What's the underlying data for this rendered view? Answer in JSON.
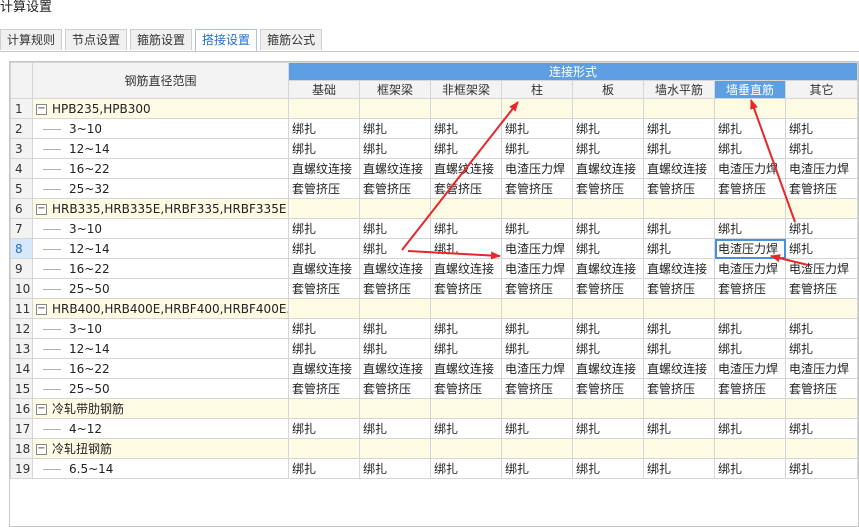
{
  "window": {
    "title": "计算设置"
  },
  "tabs": [
    {
      "label": "计算规则",
      "active": false
    },
    {
      "label": "节点设置",
      "active": false
    },
    {
      "label": "箍筋设置",
      "active": false
    },
    {
      "label": "搭接设置",
      "active": true
    },
    {
      "label": "箍筋公式",
      "active": false
    }
  ],
  "grid": {
    "range_header": "钢筋直径范围",
    "group_header": "连接形式",
    "columns": [
      "基础",
      "框架梁",
      "非框架梁",
      "柱",
      "板",
      "墙水平筋",
      "墙垂直筋",
      "其它"
    ],
    "active_column_index": 6,
    "selected_row_number": "8",
    "rows": [
      {
        "n": "1",
        "group": true,
        "label": "HPB235,HPB300"
      },
      {
        "n": "2",
        "label": "3~10",
        "cells": [
          "绑扎",
          "绑扎",
          "绑扎",
          "绑扎",
          "绑扎",
          "绑扎",
          "绑扎",
          "绑扎"
        ]
      },
      {
        "n": "3",
        "label": "12~14",
        "cells": [
          "绑扎",
          "绑扎",
          "绑扎",
          "绑扎",
          "绑扎",
          "绑扎",
          "绑扎",
          "绑扎"
        ]
      },
      {
        "n": "4",
        "label": "16~22",
        "cells": [
          "直螺纹连接",
          "直螺纹连接",
          "直螺纹连接",
          "电渣压力焊",
          "直螺纹连接",
          "直螺纹连接",
          "电渣压力焊",
          "电渣压力焊"
        ]
      },
      {
        "n": "5",
        "label": "25~32",
        "cells": [
          "套管挤压",
          "套管挤压",
          "套管挤压",
          "套管挤压",
          "套管挤压",
          "套管挤压",
          "套管挤压",
          "套管挤压"
        ]
      },
      {
        "n": "6",
        "group": true,
        "label": "HRB335,HRB335E,HRBF335,HRBF335E"
      },
      {
        "n": "7",
        "label": "3~10",
        "cells": [
          "绑扎",
          "绑扎",
          "绑扎",
          "绑扎",
          "绑扎",
          "绑扎",
          "绑扎",
          "绑扎"
        ]
      },
      {
        "n": "8",
        "label": "12~14",
        "cells": [
          "绑扎",
          "绑扎",
          "绑扎",
          "电渣压力焊",
          "绑扎",
          "绑扎",
          "电渣压力焊",
          "绑扎"
        ]
      },
      {
        "n": "9",
        "label": "16~22",
        "cells": [
          "直螺纹连接",
          "直螺纹连接",
          "直螺纹连接",
          "电渣压力焊",
          "直螺纹连接",
          "直螺纹连接",
          "电渣压力焊",
          "电渣压力焊"
        ]
      },
      {
        "n": "10",
        "label": "25~50",
        "cells": [
          "套管挤压",
          "套管挤压",
          "套管挤压",
          "套管挤压",
          "套管挤压",
          "套管挤压",
          "套管挤压",
          "套管挤压"
        ]
      },
      {
        "n": "11",
        "group": true,
        "label": "HRB400,HRB400E,HRBF400,HRBF400E..."
      },
      {
        "n": "12",
        "label": "3~10",
        "cells": [
          "绑扎",
          "绑扎",
          "绑扎",
          "绑扎",
          "绑扎",
          "绑扎",
          "绑扎",
          "绑扎"
        ]
      },
      {
        "n": "13",
        "label": "12~14",
        "cells": [
          "绑扎",
          "绑扎",
          "绑扎",
          "绑扎",
          "绑扎",
          "绑扎",
          "绑扎",
          "绑扎"
        ]
      },
      {
        "n": "14",
        "label": "16~22",
        "cells": [
          "直螺纹连接",
          "直螺纹连接",
          "直螺纹连接",
          "电渣压力焊",
          "直螺纹连接",
          "直螺纹连接",
          "电渣压力焊",
          "电渣压力焊"
        ]
      },
      {
        "n": "15",
        "label": "25~50",
        "cells": [
          "套管挤压",
          "套管挤压",
          "套管挤压",
          "套管挤压",
          "套管挤压",
          "套管挤压",
          "套管挤压",
          "套管挤压"
        ]
      },
      {
        "n": "16",
        "group": true,
        "label": "冷轧带肋钢筋"
      },
      {
        "n": "17",
        "label": "4~12",
        "cells": [
          "绑扎",
          "绑扎",
          "绑扎",
          "绑扎",
          "绑扎",
          "绑扎",
          "绑扎",
          "绑扎"
        ]
      },
      {
        "n": "18",
        "group": true,
        "label": "冷轧扭钢筋"
      },
      {
        "n": "19",
        "label": "6.5~14",
        "cells": [
          "绑扎",
          "绑扎",
          "绑扎",
          "绑扎",
          "绑扎",
          "绑扎",
          "绑扎",
          "绑扎"
        ]
      }
    ]
  },
  "colors": {
    "accent": "#5e9fe3",
    "group_row_bg": "#fefbe4",
    "annotation_arrow": "#e8262b"
  }
}
